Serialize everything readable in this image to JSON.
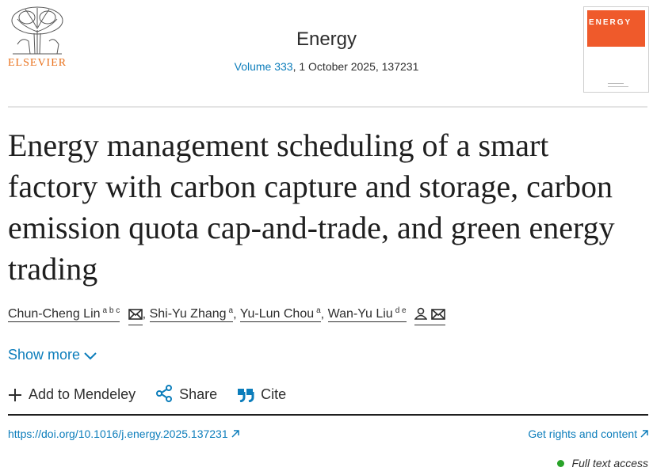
{
  "header": {
    "publisher": "ELSEVIER",
    "journal": "Energy",
    "volume_link": "Volume 333",
    "issue_rest": ", 1 October 2025, 137231",
    "cover_title": "ENERGY"
  },
  "article": {
    "title": "Energy management scheduling of a smart factory with carbon capture and storage, carbon emission quota cap-and-trade, and green energy trading",
    "authors": [
      {
        "name": "Chun-Cheng Lin",
        "sup": "a b c",
        "sep": ""
      },
      {
        "name": "Shi-Yu Zhang",
        "sup": "a",
        "sep": ","
      },
      {
        "name": "Yu-Lun Chou",
        "sup": "a",
        "sep": ","
      },
      {
        "name": "Wan-Yu Liu",
        "sup": "d e",
        "sep": ","
      }
    ],
    "show_more": "Show more"
  },
  "actions": {
    "mendeley": "Add to Mendeley",
    "share": "Share",
    "cite": "Cite"
  },
  "links": {
    "doi": "https://doi.org/10.1016/j.energy.2025.137231",
    "rights": "Get rights and content",
    "access": "Full text access"
  },
  "colors": {
    "link": "#0c7dbb",
    "publisher_orange": "#e9711c",
    "access_green": "#29a329",
    "cover_orange": "#ef5a2b"
  }
}
